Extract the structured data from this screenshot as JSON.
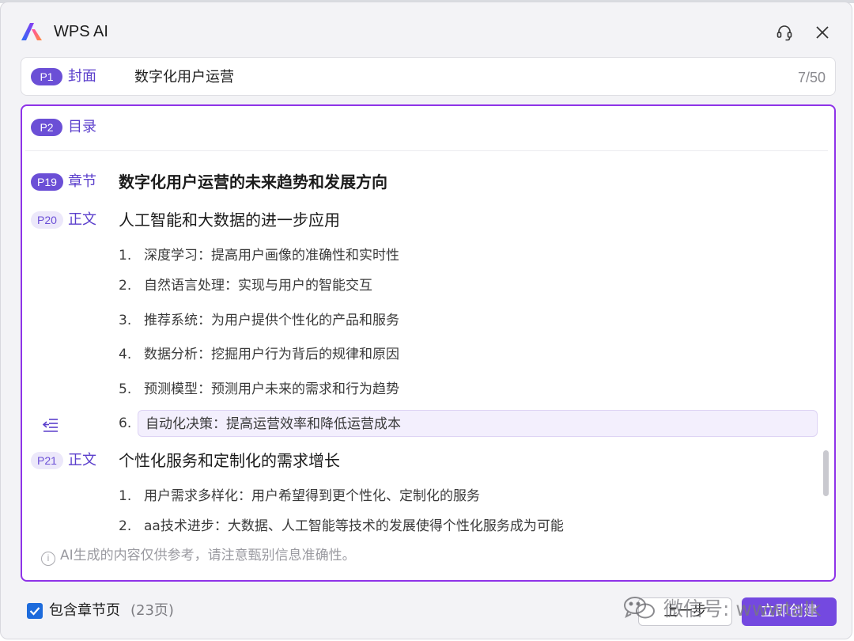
{
  "app": {
    "title": "WPS AI"
  },
  "cover": {
    "badge": "P1",
    "type": "封面",
    "text": "数字化用户运营",
    "counter": "7/50"
  },
  "toc": {
    "badge": "P2",
    "type": "目录"
  },
  "sections": [
    {
      "badge": "P19",
      "type": "章节",
      "heading": "数字化用户运营的未来趋势和发展方向"
    },
    {
      "badge": "P20",
      "type": "正文",
      "heading": "人工智能和大数据的进一步应用",
      "items": [
        {
          "num": "1.",
          "text": "深度学习：提高用户画像的准确性和实时性"
        },
        {
          "num": "2.",
          "text": "自然语言处理：实现与用户的智能交互"
        },
        {
          "num": "3.",
          "text": "推荐系统：为用户提供个性化的产品和服务"
        },
        {
          "num": "4.",
          "text": "数据分析：挖掘用户行为背后的规律和原因"
        },
        {
          "num": "5.",
          "text": "预测模型：预测用户未来的需求和行为趋势"
        },
        {
          "num": "6.",
          "text": "自动化决策：提高运营效率和降低运营成本"
        }
      ]
    },
    {
      "badge": "P21",
      "type": "正文",
      "heading": "个性化服务和定制化的需求增长",
      "items": [
        {
          "num": "1.",
          "text": "用户需求多样化：用户希望得到更个性化、定制化的服务"
        },
        {
          "num": "2.",
          "text": "aa技术进步：大数据、人工智能等技术的发展使得个性化服务成为可能"
        }
      ]
    }
  ],
  "disclaimer": "AI生成的内容仅供参考，请注意甄别信息准确性。",
  "footer": {
    "checkbox_label": "包含章节页",
    "pages": "(23页)",
    "prev_label": "上一步",
    "create_label": "立即创建",
    "watermark": "微信号: wwwtalk"
  },
  "colors": {
    "accent": "#6b4fd6",
    "panel_border": "#8e33e8",
    "primary_button": "#7449e0",
    "checkbox": "#1d6bdc"
  }
}
